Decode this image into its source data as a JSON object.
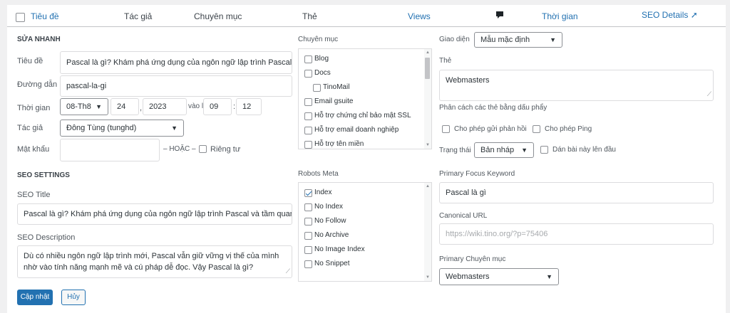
{
  "header": {
    "title_col": "Tiêu đề",
    "author_col": "Tác giả",
    "category_col": "Chuyên mục",
    "tags_col": "Thẻ",
    "views_col": "Views",
    "time_col": "Thời gian",
    "seo_details": "SEO Details"
  },
  "quick_edit": {
    "heading": "SỬA NHANH",
    "title_label": "Tiêu đề",
    "title_value": "Pascal là gì? Khám phá ứng dụng của ngôn ngữ lập trình Pascal v",
    "slug_label": "Đường dẫn",
    "slug_value": "pascal-la-gi",
    "date_label": "Thời gian",
    "month_value": "08-Th8",
    "day_value": "24",
    "year_value": "2023",
    "at_label": "vào lúc",
    "hour_value": "09",
    "minute_value": "12",
    "author_label": "Tác giả",
    "author_value": "Đông Tùng (tunghd)",
    "password_label": "Mật khẩu",
    "password_value": "",
    "or_label": "– HOẶC –",
    "private_label": "Riêng tư"
  },
  "categories": {
    "label": "Chuyên mục",
    "items": [
      {
        "label": "Blog",
        "checked": false
      },
      {
        "label": "Docs",
        "checked": false
      },
      {
        "label": "TinoMail",
        "checked": false
      },
      {
        "label": "Email gsuite",
        "checked": false
      },
      {
        "label": "Hỗ trợ chứng chỉ bảo mật SSL",
        "checked": false
      },
      {
        "label": "Hỗ trợ email doanh nghiệp",
        "checked": false
      },
      {
        "label": "Hỗ trợ tên miền",
        "checked": false
      }
    ]
  },
  "right_panel": {
    "theme_label": "Giao diện",
    "theme_value": "Mẫu mặc định",
    "tags_label": "Thẻ",
    "tags_value": "Webmasters",
    "tags_hint": "Phân cách các thẻ bằng dấu phẩy",
    "allow_comments": "Cho phép gửi phản hồi",
    "allow_pings": "Cho phép Ping",
    "status_label": "Trạng thái",
    "status_value": "Bản nháp",
    "sticky_label": "Dán bài này lên đầu"
  },
  "seo": {
    "heading": "SEO SETTINGS",
    "title_label": "SEO Title",
    "title_value": "Pascal là gì? Khám phá ứng dụng của ngôn ngữ lập trình Pascal và tầm quan t",
    "desc_label": "SEO Description",
    "desc_value": "Dù có nhiều ngôn ngữ lập trình mới, Pascal vẫn giữ vững vị thế của mình nhờ vào tính năng mạnh mẽ và cú pháp dễ đọc. Vậy Pascal là gì?",
    "robots_label": "Robots Meta",
    "robots": [
      {
        "label": "Index",
        "checked": true
      },
      {
        "label": "No Index",
        "checked": false
      },
      {
        "label": "No Follow",
        "checked": false
      },
      {
        "label": "No Archive",
        "checked": false
      },
      {
        "label": "No Image Index",
        "checked": false
      },
      {
        "label": "No Snippet",
        "checked": false
      }
    ],
    "focus_label": "Primary Focus Keyword",
    "focus_value": "Pascal là gì",
    "canonical_label": "Canonical URL",
    "canonical_placeholder": "https://wiki.tino.org/?p=75406",
    "primary_cat_label": "Primary Chuyên mục",
    "primary_cat_value": "Webmasters"
  },
  "buttons": {
    "update": "Cập nhật",
    "cancel": "Hủy"
  },
  "colors": {
    "accent": "#2271b1",
    "background": "#f0f0f1"
  }
}
